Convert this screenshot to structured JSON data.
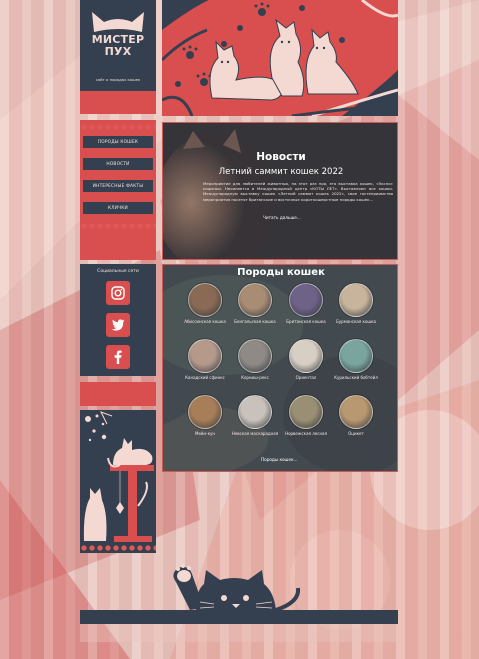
{
  "logo": {
    "title_line1": "МИСТЕР",
    "title_line2": "ПУХ",
    "subtitle": "сайт о породах кошек"
  },
  "menu": [
    {
      "label": "Породы кошек"
    },
    {
      "label": "Новости"
    },
    {
      "label": "Интересные факты"
    },
    {
      "label": "Клички"
    }
  ],
  "social": {
    "title": "Социальные сети",
    "icons": [
      "instagram-icon",
      "twitter-icon",
      "facebook-icon"
    ]
  },
  "news": {
    "section_title": "Новости",
    "headline": "Летний саммит кошек 2022",
    "body": "Мероприятие для любителей животных, на этот раз про, это выставка кошек, «Экспо» кошачьи. Начинается в Международный центр «КОТЫ ЛЕТ». Выставляют все кошки. Международную выставку кошек «Летний саммит кошек 2022», свое гостеприимство мероприятия посетят британские и восточные короткошерстные породы кошек...",
    "read_more": "Читать дальше..."
  },
  "breeds": {
    "section_title": "Породы кошек",
    "items": [
      {
        "name": "Абиссинская кошка",
        "color": "#8a6a55"
      },
      {
        "name": "Бенгальская кошка",
        "color": "#a88c74"
      },
      {
        "name": "Британская кошка",
        "color": "#6e6287"
      },
      {
        "name": "Бурманская кошка",
        "color": "#c8b49c"
      },
      {
        "name": "Канадский сфинкс",
        "color": "#b59a8c"
      },
      {
        "name": "Корниш-рекс",
        "color": "#8f8a86"
      },
      {
        "name": "Ориентал",
        "color": "#d8cfc4"
      },
      {
        "name": "Курильский бобтейл",
        "color": "#7aa59e"
      },
      {
        "name": "Мейн-кун",
        "color": "#a87e58"
      },
      {
        "name": "Невская маскарадная",
        "color": "#c9c2bc"
      },
      {
        "name": "Норвежская лесная",
        "color": "#9a8e74"
      },
      {
        "name": "Оцикет",
        "color": "#b89870"
      }
    ],
    "more": "Породы кошек..."
  },
  "colors": {
    "navy": "#34404f",
    "red": "#d94f4f",
    "pink": "#f4d9d3"
  }
}
